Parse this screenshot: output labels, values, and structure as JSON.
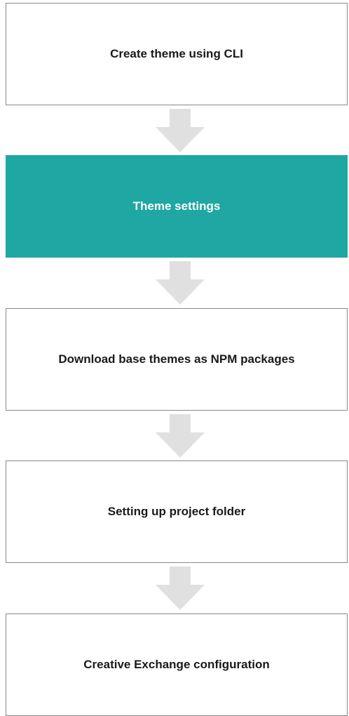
{
  "colors": {
    "active_fill": "#1fa7a3",
    "active_text": "#ffffff",
    "box_border": "#8a8a8a",
    "arrow": "#e0e0e0"
  },
  "steps": [
    {
      "label": "Create theme using CLI",
      "active": false
    },
    {
      "label": "Theme settings",
      "active": true
    },
    {
      "label": "Download base themes as NPM packages",
      "active": false
    },
    {
      "label": "Setting up project folder",
      "active": false
    },
    {
      "label": "Creative Exchange configuration",
      "active": false
    }
  ],
  "arrow_icon": "arrow-down-icon"
}
